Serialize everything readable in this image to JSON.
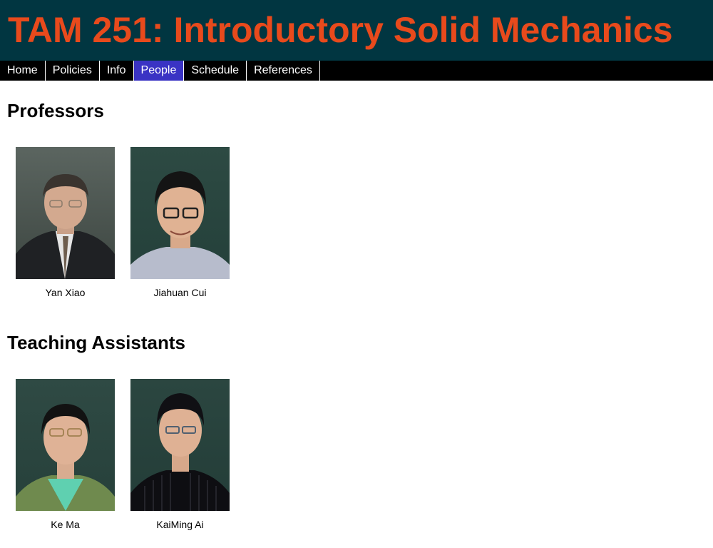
{
  "header": {
    "title": "TAM 251: Introductory Solid Mechanics"
  },
  "nav": {
    "items": [
      {
        "label": "Home"
      },
      {
        "label": "Policies"
      },
      {
        "label": "Info"
      },
      {
        "label": "People"
      },
      {
        "label": "Schedule"
      },
      {
        "label": "References"
      }
    ],
    "active": "People"
  },
  "professors": {
    "heading": "Professors",
    "people": [
      {
        "name": "Yan Xiao"
      },
      {
        "name": "Jiahuan Cui"
      }
    ]
  },
  "tas": {
    "heading": "Teaching Assistants",
    "people": [
      {
        "name": "Ke Ma"
      },
      {
        "name": "KaiMing Ai"
      }
    ]
  },
  "colors": {
    "banner_bg": "#013641",
    "title": "#e84a1c",
    "nav_bg": "#000000",
    "nav_active": "#3a33c4"
  }
}
